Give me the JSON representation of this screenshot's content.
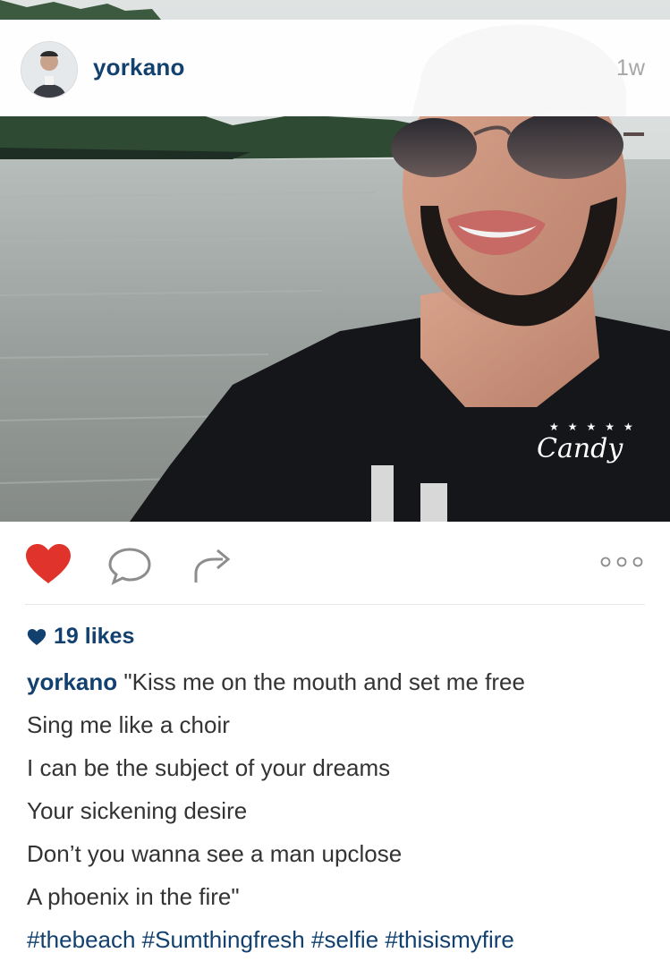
{
  "post": {
    "username": "yorkano",
    "time_ago": "1w",
    "watermark": "Candy",
    "watermark_stars": "★★★★★"
  },
  "actions": {
    "like_icon": "heart-icon",
    "comment_icon": "comment-icon",
    "share_icon": "share-arrow-icon",
    "more_icon": "more-options-icon",
    "like_color": "#e0332b"
  },
  "likes": {
    "count_text": "19 likes"
  },
  "caption": {
    "username": "yorkano",
    "lines": [
      "\"Kiss me on the mouth and set me free",
      "Sing me like a choir",
      "I can be the subject of your dreams",
      "Your sickening desire",
      "Don’t you wanna see a man upclose",
      "A phoenix in the fire\""
    ],
    "hashtags": "#thebeach #Sumthingfresh #selfie #thisismyfire"
  },
  "colors": {
    "link_blue": "#12406f",
    "muted_gray": "#a6a6a6"
  }
}
